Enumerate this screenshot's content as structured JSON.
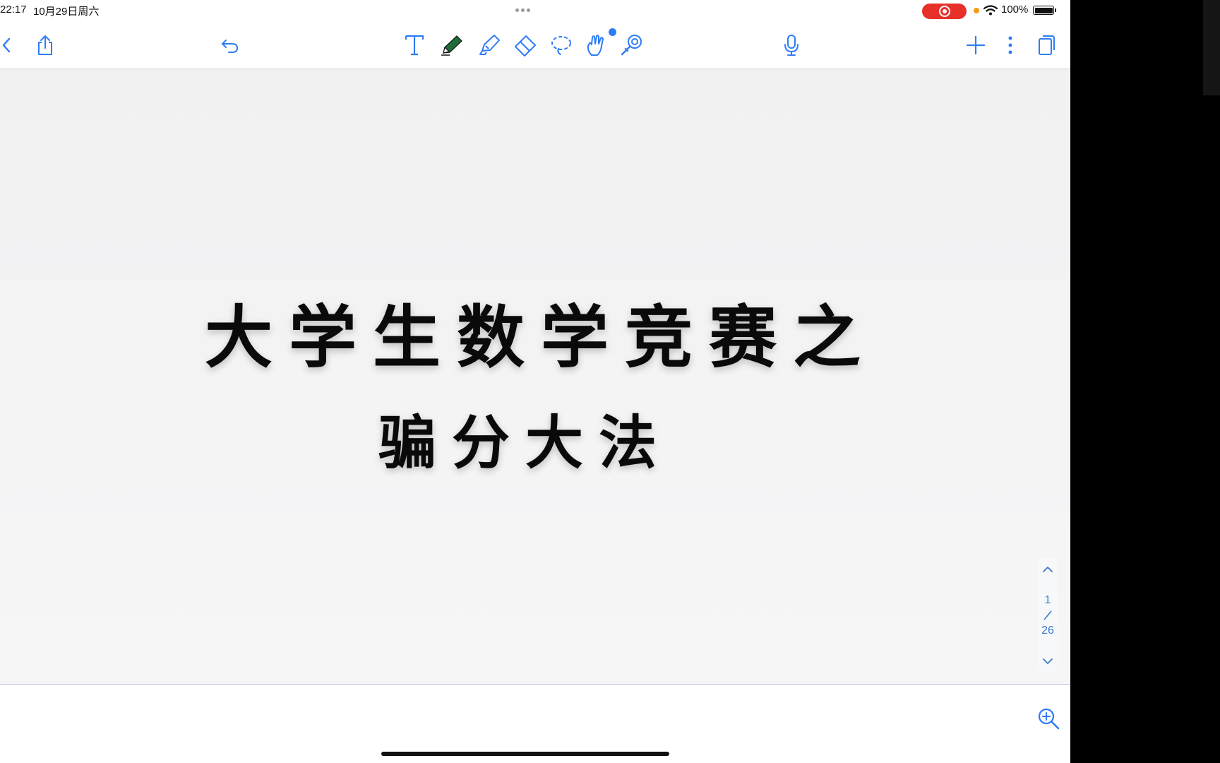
{
  "status_bar": {
    "time": "22:17",
    "date": "10月29日周六",
    "battery_percent": "100%",
    "recording_color": "#e8302a"
  },
  "toolbar": {
    "left": [
      "back-icon",
      "share-icon",
      "undo-icon"
    ],
    "tools": [
      "text-tool-icon",
      "pen-tool-icon",
      "highlighter-tool-icon",
      "eraser-tool-icon",
      "lasso-tool-icon",
      "hand-draw-tool-icon",
      "laser-pointer-tool-icon"
    ],
    "right": [
      "microphone-icon",
      "add-page-icon",
      "more-options-icon",
      "pages-view-icon"
    ],
    "accent_color": "#2f7cf6",
    "pen_color": "#1f6b3a"
  },
  "document": {
    "title_line1": "大学生数学竞赛之",
    "title_line2": "骗分大法"
  },
  "page_indicator": {
    "current": "1",
    "total": "26"
  }
}
